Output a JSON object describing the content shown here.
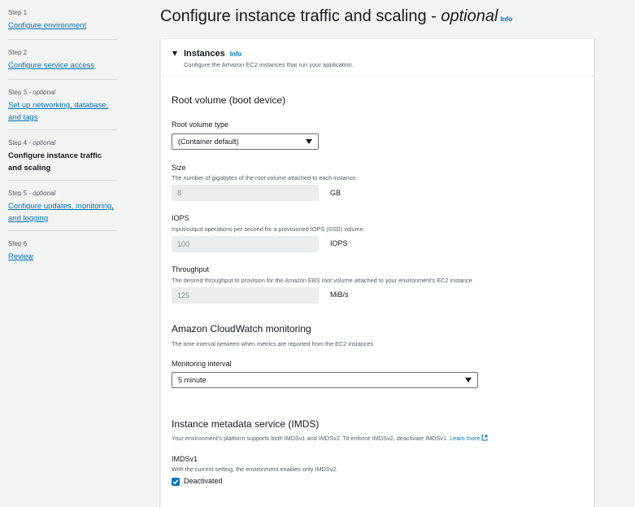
{
  "steps": [
    {
      "label": "Step 1",
      "optional": "",
      "title": "Configure environment"
    },
    {
      "label": "Step 2",
      "optional": "",
      "title": "Configure service access"
    },
    {
      "label": "Step 3 - ",
      "optional": "optional",
      "title": "Set up networking, database, and tags"
    },
    {
      "label": "Step 4 - ",
      "optional": "optional",
      "title": "Configure instance traffic and scaling"
    },
    {
      "label": "Step 5 - ",
      "optional": "optional",
      "title": "Configure updates, monitoring, and logging"
    },
    {
      "label": "Step 6",
      "optional": "",
      "title": "Review"
    }
  ],
  "header": {
    "title": "Configure instance traffic and scaling - ",
    "title_optional": "optional",
    "info": "Info"
  },
  "instances": {
    "title": "Instances",
    "info": "Info",
    "description": "Configure the Amazon EC2 instances that run your application."
  },
  "root_volume": {
    "section_title": "Root volume (boot device)",
    "type_label": "Root volume type",
    "type_value": "(Container default)",
    "size_label": "Size",
    "size_desc": "The number of gigabytes of the root volume attached to each instance.",
    "size_value": "8",
    "size_unit": "GB",
    "iops_label": "IOPS",
    "iops_desc": "Input/output operations per second for a provisioned IOPS (SSD) volume.",
    "iops_value": "100",
    "iops_unit": "IOPS",
    "throughput_label": "Throughput",
    "throughput_desc": "The desired throughput to provision for the Amazon EBS root volume attached to your environment's EC2 instance",
    "throughput_value": "125",
    "throughput_unit": "MiB/s"
  },
  "cloudwatch": {
    "section_title": "Amazon CloudWatch monitoring",
    "desc": "The time interval between when metrics are reported from the EC2 instances",
    "interval_label": "Monitoring interval",
    "interval_value": "5 minute"
  },
  "imds": {
    "section_title": "Instance metadata service (IMDS)",
    "desc": "Your environment's platform supports both IMDSv1 and IMDSv2. To enforce IMDSv2, deactivate IMDSv1.",
    "learn_more": "Learn more",
    "v1_label": "IMDSv1",
    "v1_desc": "With the current setting, the environment enables only IMDSv2.",
    "checkbox_label": "Deactivated"
  },
  "colors": {
    "link": "#0073bb",
    "background": "#f2f3f3"
  }
}
